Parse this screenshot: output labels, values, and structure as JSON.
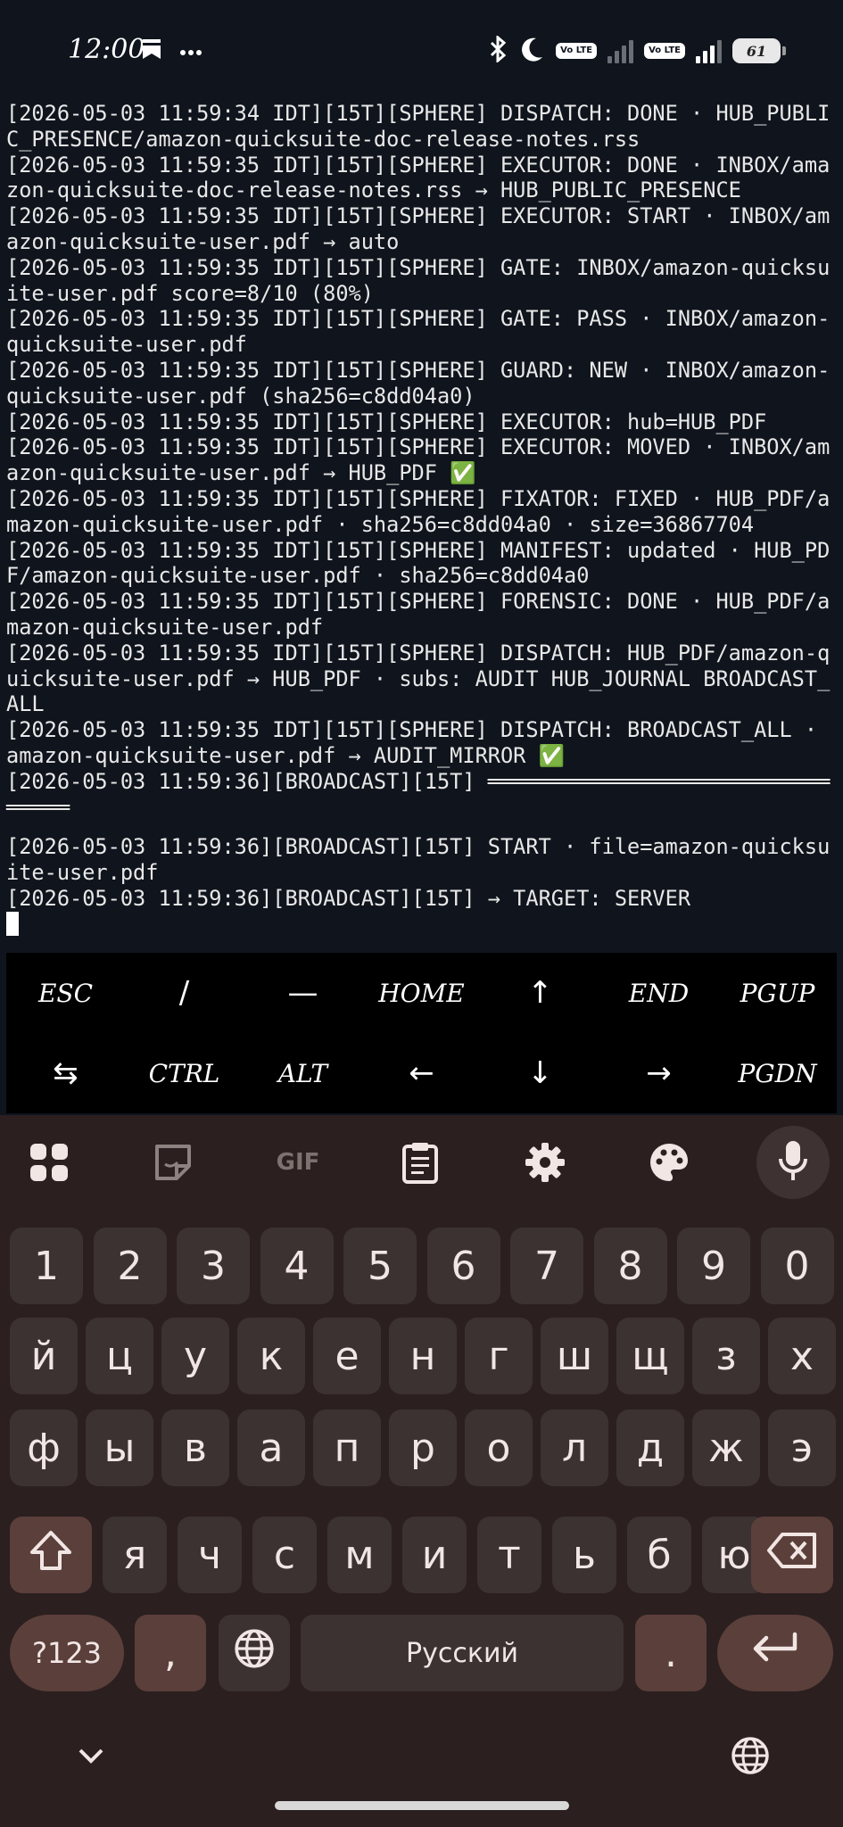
{
  "status_bar": {
    "time": "12:00",
    "volte_1": "Vo LTE",
    "volte_2": "Vo LTE",
    "battery": "61",
    "battery_fraction": 0.61,
    "icons": [
      "bookmark-icon",
      "more-icon",
      "bluetooth-icon",
      "do-not-disturb-moon-icon",
      "signal-icon",
      "battery-icon"
    ]
  },
  "terminal": {
    "lines": [
      "[2026-05-03 11:59:34 IDT][15T][SPHERE] DISPATCH: DONE · HUB_PUBLIC_PRESENCE/amazon-quicksuite-doc-release-notes.rss",
      "[2026-05-03 11:59:35 IDT][15T][SPHERE] EXECUTOR: DONE · INBOX/amazon-quicksuite-doc-release-notes.rss → HUB_PUBLIC_PRESENCE",
      "[2026-05-03 11:59:35 IDT][15T][SPHERE] EXECUTOR: START · INBOX/amazon-quicksuite-user.pdf → auto",
      "[2026-05-03 11:59:35 IDT][15T][SPHERE] GATE: INBOX/amazon-quicksuite-user.pdf score=8/10 (80%)",
      "[2026-05-03 11:59:35 IDT][15T][SPHERE] GATE: PASS · INBOX/amazon-quicksuite-user.pdf",
      "[2026-05-03 11:59:35 IDT][15T][SPHERE] GUARD: NEW · INBOX/amazon-quicksuite-user.pdf (sha256=c8dd04a0)",
      "[2026-05-03 11:59:35 IDT][15T][SPHERE] EXECUTOR: hub=HUB_PDF",
      "[2026-05-03 11:59:35 IDT][15T][SPHERE] EXECUTOR: MOVED · INBOX/amazon-quicksuite-user.pdf → HUB_PDF ✅",
      "[2026-05-03 11:59:35 IDT][15T][SPHERE] FIXATOR: FIXED · HUB_PDF/amazon-quicksuite-user.pdf · sha256=c8dd04a0 · size=36867704",
      "[2026-05-03 11:59:35 IDT][15T][SPHERE] MANIFEST: updated · HUB_PDF/amazon-quicksuite-user.pdf · sha256=c8dd04a0",
      "[2026-05-03 11:59:35 IDT][15T][SPHERE] FORENSIC: DONE · HUB_PDF/amazon-quicksuite-user.pdf",
      "[2026-05-03 11:59:35 IDT][15T][SPHERE] DISPATCH: HUB_PDF/amazon-quicksuite-user.pdf → HUB_PDF · subs: AUDIT HUB_JOURNAL BROADCAST_ALL",
      "[2026-05-03 11:59:35 IDT][15T][SPHERE] DISPATCH: BROADCAST_ALL · amazon-quicksuite-user.pdf → AUDIT_MIRROR ✅",
      "[2026-05-03 11:59:36][BROADCAST][15T] ════════════════════════════════",
      "[2026-05-03 11:59:36][BROADCAST][15T] START · file=amazon-quicksuite-user.pdf",
      "[2026-05-03 11:59:36][BROADCAST][15T] → TARGET: SERVER"
    ]
  },
  "extra_keys": {
    "row1": [
      "ESC",
      "/",
      "—",
      "HOME",
      "↑",
      "END",
      "PGUP"
    ],
    "row2": [
      "⇆",
      "CTRL",
      "ALT",
      "←",
      "↓",
      "→",
      "PGDN"
    ]
  },
  "keyboard": {
    "toolbar": [
      "apps-grid-icon",
      "sticker-icon",
      "GIF",
      "clipboard-icon",
      "settings-gear-icon",
      "palette-icon",
      "microphone-icon"
    ],
    "gif_label": "GIF",
    "numbers": [
      "1",
      "2",
      "3",
      "4",
      "5",
      "6",
      "7",
      "8",
      "9",
      "0"
    ],
    "row1": [
      "й",
      "ц",
      "у",
      "к",
      "е",
      "н",
      "г",
      "ш",
      "щ",
      "з",
      "х"
    ],
    "row2": [
      "ф",
      "ы",
      "в",
      "а",
      "п",
      "р",
      "о",
      "л",
      "д",
      "ж",
      "э"
    ],
    "row3": [
      "я",
      "ч",
      "с",
      "м",
      "и",
      "т",
      "ь",
      "б",
      "ю"
    ],
    "sym_label": "?123",
    "comma": ",",
    "space_label": "Русский",
    "period": "."
  },
  "colors": {
    "terminal_bg": "#0f141d",
    "keyboard_bg": "#2b1f1f",
    "key_bg": "#3d3232",
    "mod_key_bg": "#5b3f3a"
  }
}
